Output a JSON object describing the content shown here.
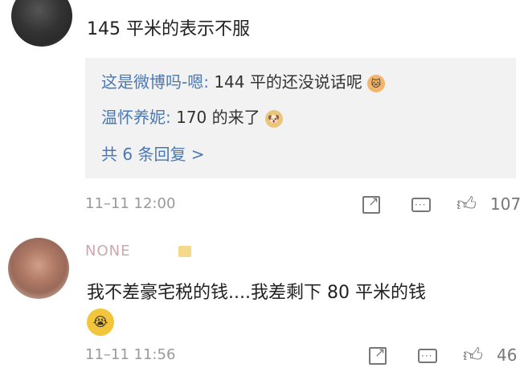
{
  "comments": [
    {
      "text": "145 平米的表示不服",
      "timestamp": "11–11 12:00",
      "like_count": "107",
      "replies": [
        {
          "user": "这是微博吗-嗯:",
          "text": " 144 平的还没说话呢",
          "emoji": "cat-emoji"
        },
        {
          "user": "温怀养妮:",
          "text": " 170 的来了",
          "emoji": "doge-emoji"
        }
      ],
      "more_replies": "共 6 条回复 >"
    },
    {
      "username": "NONE",
      "text": "我不差豪宅税的钱....我差剩下 80 平米的钱",
      "emoji": "crying-emoji",
      "timestamp": "11–11 11:56",
      "like_count": "46"
    }
  ],
  "colors": {
    "link": "#4a78b3",
    "reply_bg": "#f2f2f2",
    "meta": "#9a9a9a"
  }
}
